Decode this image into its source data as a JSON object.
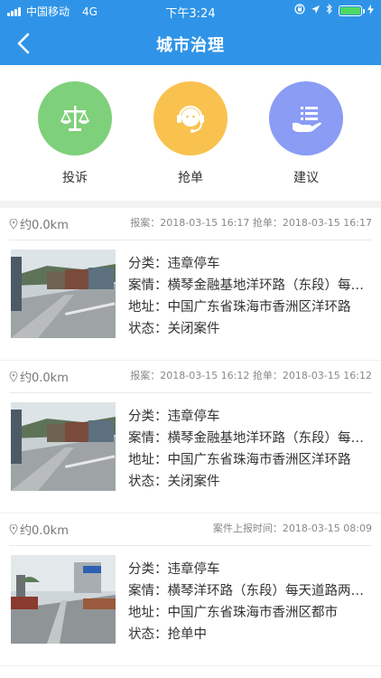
{
  "status_bar": {
    "carrier": "中国移动",
    "network": "4G",
    "time": "下午3:24"
  },
  "nav": {
    "title": "城市治理"
  },
  "actions": [
    {
      "label": "投诉",
      "icon": "scales-icon",
      "color": "#7fd07a"
    },
    {
      "label": "抢单",
      "icon": "headset-agent-icon",
      "color": "#f9c24f"
    },
    {
      "label": "建议",
      "icon": "hand-list-icon",
      "color": "#8a9cf4"
    }
  ],
  "cases": [
    {
      "distance": "约0.0km",
      "times": "报案：2018-03-15 16:17   抢单：2018-03-15 16:17",
      "category": "分类：违章停车",
      "detail": "案情：横琴金融基地洋环路（东段）每天道路两旁停满货车",
      "address": "地址：中国广东省珠海市香洲区洋环路",
      "state": "状态：关闭案件"
    },
    {
      "distance": "约0.0km",
      "times": "报案：2018-03-15 16:12   抢单：2018-03-15 16:12",
      "category": "分类：违章停车",
      "detail": "案情：横琴金融基地洋环路（东段）每天道路两旁停满货车",
      "address": "地址：中国广东省珠海市香洲区洋环路",
      "state": "状态：关闭案件"
    },
    {
      "distance": "约0.0km",
      "times": "案件上报时间：2018-03-15 08:09",
      "category": "分类：违章停车",
      "detail": "案情：横琴洋环路（东段）每天道路两旁停满货车",
      "address": "地址：中国广东省珠海市香洲区都市",
      "state": "状态：抢单中"
    }
  ]
}
